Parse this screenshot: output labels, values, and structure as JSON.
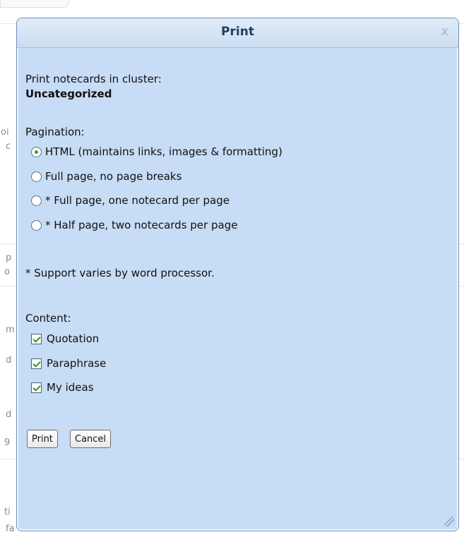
{
  "background": {
    "fragments": [
      "oi",
      "c",
      "p",
      "o",
      "m",
      "d",
      "d",
      "9",
      "ti",
      "fa"
    ]
  },
  "dialog": {
    "title": "Print",
    "close_glyph": "x",
    "cluster_label": "Print notecards in cluster:",
    "cluster_name": "Uncategorized",
    "pagination_label": "Pagination:",
    "pagination_options": [
      {
        "label": "HTML (maintains links, images & formatting)",
        "selected": true
      },
      {
        "label": "Full page, no page breaks",
        "selected": false
      },
      {
        "label": "* Full page, one notecard per page",
        "selected": false
      },
      {
        "label": "* Half page, two notecards per page",
        "selected": false
      }
    ],
    "support_note": "* Support varies by word processor.",
    "content_label": "Content:",
    "content_options": [
      {
        "label": "Quotation",
        "checked": true
      },
      {
        "label": "Paraphrase",
        "checked": true
      },
      {
        "label": "My ideas",
        "checked": true
      }
    ],
    "print_button": "Print",
    "cancel_button": "Cancel"
  },
  "colors": {
    "dialog_bg": "#c7dcf5",
    "title_text": "#1f3f63",
    "radio_dot": "#2e9f3a",
    "check_mark": "#2a9a2a"
  }
}
